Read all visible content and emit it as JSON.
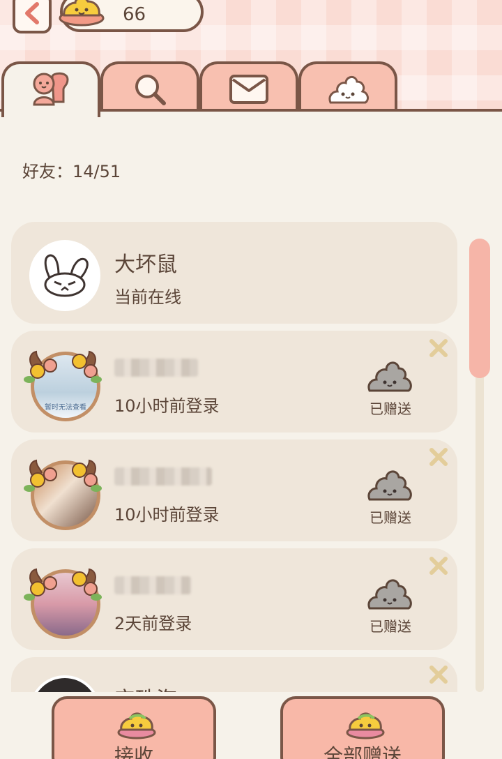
{
  "header": {
    "currency_count": "66"
  },
  "tabs": [
    {
      "name": "friends",
      "icon": "friends-icon",
      "active": true
    },
    {
      "name": "search",
      "icon": "search-icon",
      "active": false
    },
    {
      "name": "mail",
      "icon": "mail-icon",
      "active": false
    },
    {
      "name": "gift",
      "icon": "poop-gift-icon",
      "active": false
    }
  ],
  "friend_count_label": "好友：14/51",
  "friends": [
    {
      "name": "大坏鼠",
      "status": "当前在线",
      "gift_label": ""
    },
    {
      "name": "",
      "status": "10小时前登录",
      "gift_label": "已赠送"
    },
    {
      "name": "",
      "status": "10小时前登录",
      "gift_label": "已赠送"
    },
    {
      "name": "",
      "status": "2天前登录",
      "gift_label": "已赠送"
    },
    {
      "name": "宝珠海",
      "status": "",
      "gift_label": ""
    }
  ],
  "avatar_placeholder_text": "暂时无法查看",
  "buttons": {
    "receive_label": "接收",
    "send_all_label": "全部赠送"
  },
  "colors": {
    "outline": "#7a5647",
    "tab_inactive": "#f8c0b0",
    "card": "#efe6da",
    "background": "#f6f2ea",
    "accent": "#f6b5a8"
  }
}
